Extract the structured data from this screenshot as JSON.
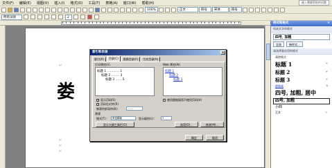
{
  "menubar": {
    "items": [
      "文件(F)",
      "编辑(E)",
      "视图(V)",
      "插入(I)",
      "格式(O)",
      "工具(T)",
      "表格(A)",
      "窗口(W)",
      "帮助(H)"
    ],
    "help_placeholder": "键入需要帮助的问题"
  },
  "toolbar": {
    "zoom": "100%",
    "style": "正文",
    "font_size": "四号",
    "font": "宋体",
    "font_size_2": "四号"
  },
  "toolbar2": {
    "style_label": "所有词语",
    "size": "2"
  },
  "document": {
    "big_char": "娄"
  },
  "dialog": {
    "title": "索引和目录",
    "close": "×",
    "tabs": [
      "索引(X)",
      "目录(C)",
      "图表目录(F)",
      "引文目录(A)"
    ],
    "print_preview_label": "打印预览(V)",
    "web_preview_label": "Web 预览(W)",
    "preview_print": [
      "标题 1 ............ 1",
      "标题 2 ........ 3",
      "标题 3 ...... 5"
    ],
    "preview_web": [
      "标题 1",
      "标题 2",
      "标题 3"
    ],
    "chk_page_numbers": "显示页码(S)",
    "chk_right_align": "页码右对齐(R)",
    "chk_hyperlinks": "使用超链接而不使用页码(H)",
    "tab_leader_label": "制表符前导符(B):",
    "tab_leader_value": ".......",
    "general_label": "常规",
    "formats_label": "格式(T):",
    "formats_value": "来自模板",
    "levels_label": "显示级别(L):",
    "levels_value": "3",
    "outline_button": "显示大纲工具栏(O)",
    "options_button": "选项(O)...",
    "modify_button": "修改(M)...",
    "ok_button": "确定",
    "cancel_button": "取消"
  },
  "pane": {
    "title": "样式和格式",
    "close": "×",
    "current_label": "所选文字的格式",
    "current_value": "四号, 加粗",
    "select_all": "全选",
    "new_style": "新样式...",
    "apply_label": "请选择要应用的格式",
    "formats": [
      {
        "label": "清除格式",
        "cls": "clear",
        "mark": ""
      },
      {
        "label": "标题 1",
        "cls": "h1",
        "mark": "↵"
      },
      {
        "label": "标题 2",
        "cls": "h2",
        "mark": "↵"
      },
      {
        "label": "标题 3",
        "cls": "h3",
        "mark": "↵"
      },
      {
        "label": "超链接",
        "cls": "link",
        "mark": "a"
      },
      {
        "label": "四号, 加粗, 居中",
        "cls": "big",
        "mark": ""
      },
      {
        "label": "四号, 加粗",
        "cls": "box",
        "mark": ""
      },
      {
        "label": "小四",
        "cls": "small",
        "mark": ""
      },
      {
        "label": "正文",
        "cls": "body",
        "mark": "↵"
      }
    ]
  }
}
